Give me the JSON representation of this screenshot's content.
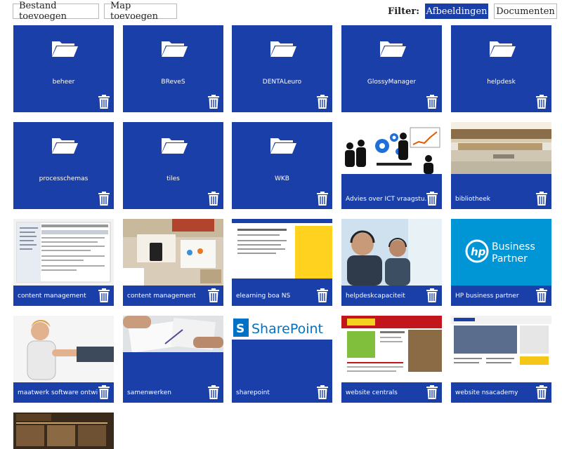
{
  "toolbar": {
    "add_file": "Bestand toevoegen",
    "add_folder": "Map toevoegen",
    "filter_label": "Filter:",
    "filter_images": "Afbeeldingen",
    "filter_documents": "Documenten",
    "active_filter": "Afbeeldingen"
  },
  "colors": {
    "tile": "#1b3fa8",
    "text_on_tile": "#ffffff"
  },
  "folders": [
    {
      "label": "beheer"
    },
    {
      "label": "BReveS"
    },
    {
      "label": "DENTALeuro"
    },
    {
      "label": "GlossyManager"
    },
    {
      "label": "helpdesk"
    },
    {
      "label": "processchemas"
    },
    {
      "label": "tiles"
    },
    {
      "label": "WKB"
    }
  ],
  "images": [
    {
      "label": "Advies over ICT vraagstu..."
    },
    {
      "label": "bibliotheek"
    },
    {
      "label": "content management"
    },
    {
      "label": "content management"
    },
    {
      "label": "elearning boa NS"
    },
    {
      "label": "helpdeskcapaciteit"
    },
    {
      "label": "HP business partner",
      "text_line1": "Business",
      "text_line2": "Partner"
    },
    {
      "label": "maatwerk software ontwi..."
    },
    {
      "label": "samenwerken"
    },
    {
      "label": "sharepoint",
      "text": "SharePoint"
    },
    {
      "label": "website centrals"
    },
    {
      "label": "website nsacademy"
    },
    {
      "label": ""
    }
  ]
}
